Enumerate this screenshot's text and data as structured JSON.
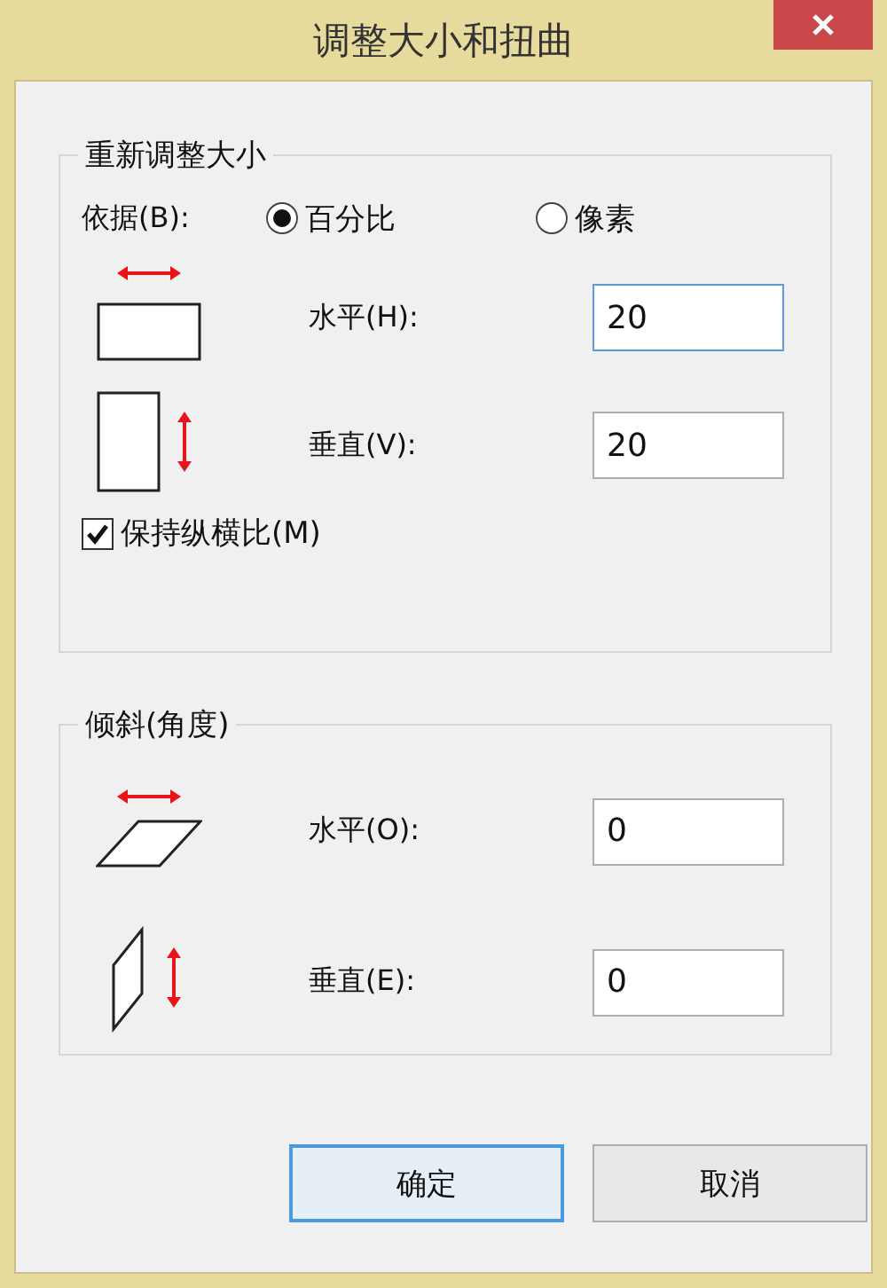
{
  "window": {
    "title": "调整大小和扭曲"
  },
  "resize": {
    "title": "重新调整大小",
    "by_label": "依据(B):",
    "units": [
      {
        "label": "百分比",
        "selected": true
      },
      {
        "label": "像素",
        "selected": false
      }
    ],
    "fields": [
      {
        "kind": "horizontal",
        "label": "水平(H):",
        "value": "20",
        "focused": true
      },
      {
        "kind": "vertical",
        "label": "垂直(V):",
        "value": "20",
        "focused": false
      }
    ],
    "keep_ratio": {
      "label": "保持纵横比(M)",
      "checked": true
    }
  },
  "skew": {
    "title": "倾斜(角度)",
    "fields": [
      {
        "kind": "horizontal",
        "label": "水平(O):",
        "value": "0",
        "focused": false
      },
      {
        "kind": "vertical",
        "label": "垂直(E):",
        "value": "0",
        "focused": false
      }
    ]
  },
  "buttons": [
    {
      "label": "确定",
      "default": true
    },
    {
      "label": "取消",
      "default": false
    }
  ]
}
